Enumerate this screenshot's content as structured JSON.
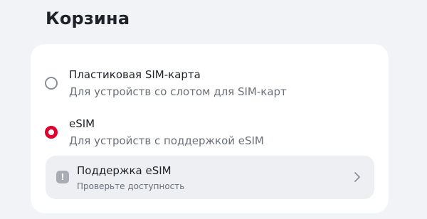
{
  "page": {
    "title": "Корзина"
  },
  "sim_options": [
    {
      "title": "Пластиковая SIM-карта",
      "subtitle": "Для устройств со слотом для SIM-карт",
      "selected": false
    },
    {
      "title": "eSIM",
      "subtitle": "Для устройств с поддержкой eSIM",
      "selected": true
    }
  ],
  "support": {
    "icon": "exclamation-icon",
    "title": "Поддержка eSIM",
    "subtitle": "Проверьте доступность"
  },
  "colors": {
    "background": "#F2F3F7",
    "card": "#FFFFFF",
    "accent": "#E0002B",
    "text_primary": "#1F2229",
    "text_secondary": "#6B6F78",
    "support_bg": "#EEEFF3"
  }
}
